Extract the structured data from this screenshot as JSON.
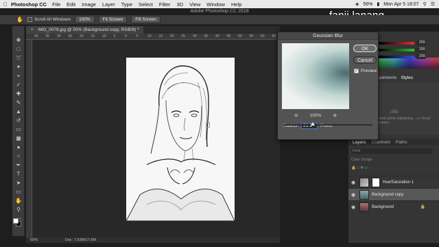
{
  "menubar": {
    "app": "Photoshop CC",
    "items": [
      "File",
      "Edit",
      "Image",
      "Layer",
      "Type",
      "Select",
      "Filter",
      "3D",
      "View",
      "Window",
      "Help"
    ],
    "battery": "56%",
    "clock": "Mon Apr 5 18:07"
  },
  "window": {
    "title": "Adobe Photoshop CC 2018"
  },
  "user": {
    "name": "fanji lanang"
  },
  "options": {
    "scroll_all": "Scroll All Windows",
    "zoom_btn": "100%",
    "fit_btn": "Fit Screen",
    "fill_btn": "Fill Screen"
  },
  "document": {
    "tab": "IMG_0078.jpg @ 50% (Background copy, RGB/8) *",
    "zoom": "50%",
    "doc_size": "Doc: 7.63M/17.6M",
    "ruler_ticks": [
      "40",
      "35",
      "30",
      "25",
      "20",
      "15",
      "10",
      "5",
      "0",
      "5",
      "10",
      "15",
      "20",
      "25",
      "30",
      "35",
      "40",
      "45",
      "50",
      "55",
      "60",
      "65"
    ]
  },
  "dialog": {
    "title": "Gaussian Blur",
    "ok": "OK",
    "cancel": "Cancel",
    "preview": "Preview",
    "preview_checked": true,
    "zoom": "100%",
    "zoom_out_icon": "zoom-out-icon",
    "zoom_in_icon": "zoom-in-icon",
    "radius_label": "Radius:",
    "radius_value": "21.9",
    "radius_unit": "Pixels",
    "radius_fraction": 0.33
  },
  "color_panel": {
    "values": [
      "255",
      "255",
      "255"
    ],
    "bar_colors": [
      "#e03030",
      "#30c030",
      "#3050e0"
    ]
  },
  "panels": {
    "tabs": [
      "ustments",
      "Styles"
    ],
    "lib_text": "...ment while initializing ...e Cloud Libraries"
  },
  "layers": {
    "tabs": [
      "Layers",
      "Channels",
      "Paths"
    ],
    "filter": "Kind",
    "blend": "Color Dodge",
    "list": [
      {
        "name": "Hue/Saturation 1",
        "type": "adjustment",
        "selected": false
      },
      {
        "name": "Background copy",
        "type": "image",
        "selected": true
      },
      {
        "name": "Background",
        "type": "image",
        "selected": false,
        "locked": true
      }
    ]
  }
}
